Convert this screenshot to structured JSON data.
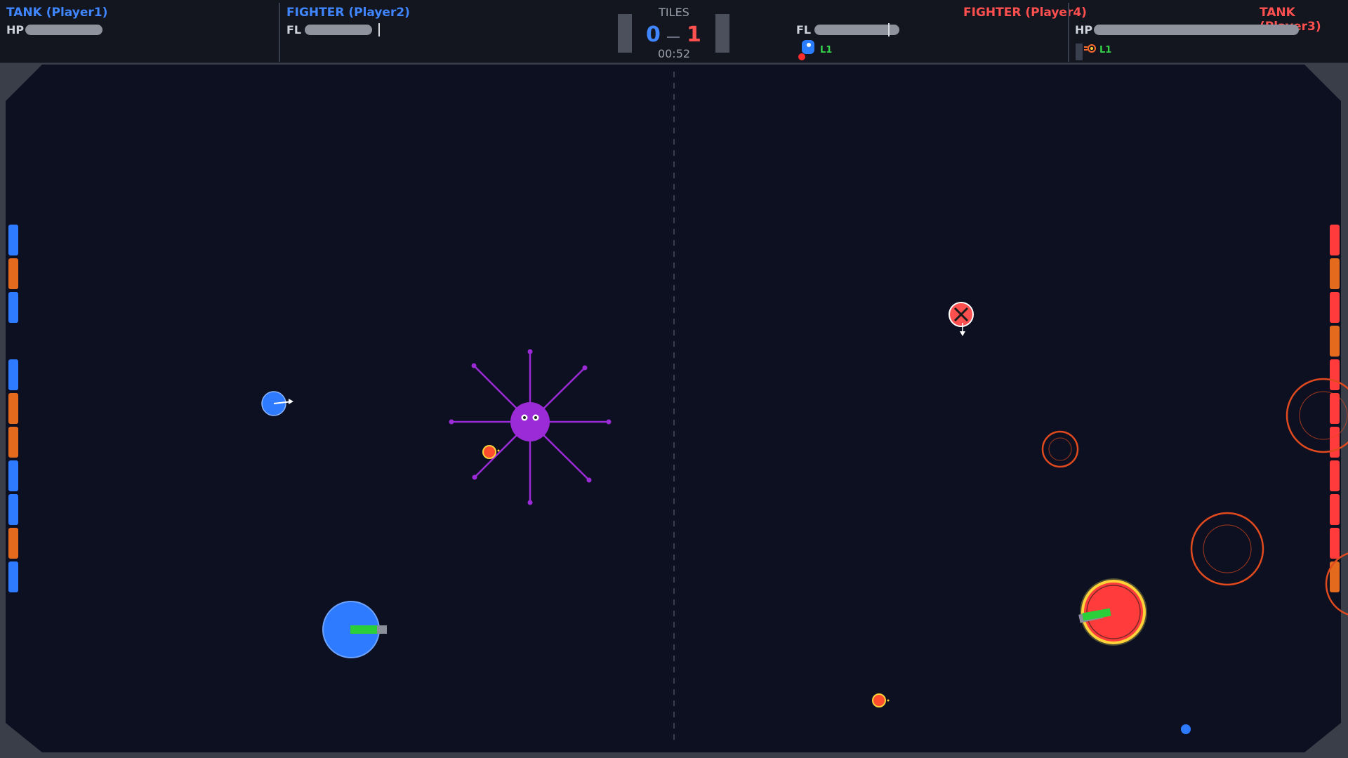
{
  "hud": {
    "p1": {
      "name": "TANK (Player1)",
      "stat_label": "HP",
      "stat_fraction": 1.0
    },
    "p2": {
      "name": "FIGHTER (Player2)",
      "stat_label": "FL",
      "stat_fraction": 1.0
    },
    "p4": {
      "name": "FIGHTER (Player4)",
      "stat_label": "FL",
      "stat_fraction": 1.0,
      "level": "L1"
    },
    "p3": {
      "name": "TANK (Player3)",
      "stat_label": "HP",
      "stat_fraction": 1.0,
      "level": "L1"
    },
    "center": {
      "title": "TILES",
      "score_blue": "0",
      "score_red": "1",
      "timer": "00:52"
    }
  },
  "colors": {
    "blue_team": "#3f86ff",
    "red_team": "#ff5050",
    "orange_tile": "#e46a1e",
    "purple_boss": "#9b2bd6",
    "arena_bg": "#0d1021"
  },
  "icons": [
    "shield-icon",
    "crosshair-icon",
    "level-badge-icon"
  ]
}
